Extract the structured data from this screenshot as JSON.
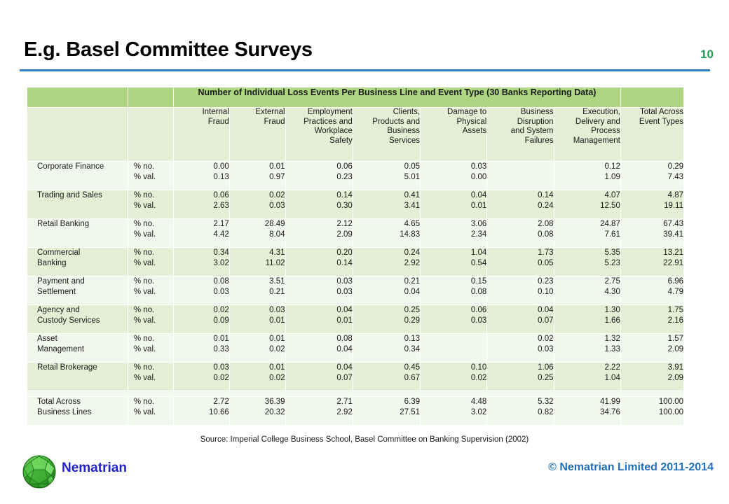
{
  "slide": {
    "title": "E.g. Basel Committee Surveys",
    "page_number": "10",
    "accent_rule_color": "#2f7fc6",
    "page_number_color": "#1f9d55"
  },
  "table": {
    "band_title": "Number of Individual Loss  Events  Per Business  Line and Event Type (30 Banks  Reporting Data)",
    "header_band_color": "#aed581",
    "row_color_light": "#f2f7ec",
    "row_color_dark": "#e3eed4",
    "column_headers": [
      "",
      "",
      "Internal\nFraud",
      "External\nFraud",
      "Employment\nPractices and\nWorkplace\nSafety",
      "Clients,\nProducts and\nBusiness\nServices",
      "Damage to\nPhysical\nAssets",
      "Business\nDisruption\nand System\nFailures",
      "Execution,\nDelivery  and\nProcess\nManagement",
      "Total Across\nEvent Types"
    ],
    "measure_labels": [
      "% no.",
      "% val."
    ],
    "rows": [
      {
        "label": "Corporate  Finance",
        "no": [
          "0.00",
          "0.01",
          "0.06",
          "0.05",
          "0.03",
          "",
          "0.12",
          "0.29"
        ],
        "val": [
          "0.13",
          "0.97",
          "0.23",
          "5.01",
          "0.00",
          "",
          "1.09",
          "7.43"
        ]
      },
      {
        "label": "Trading  and Sales",
        "no": [
          "0.06",
          "0.02",
          "0.14",
          "0.41",
          "0.04",
          "0.14",
          "4.07",
          "4.87"
        ],
        "val": [
          "2.63",
          "0.03",
          "0.30",
          "3.41",
          "0.01",
          "0.24",
          "12.50",
          "19.11"
        ]
      },
      {
        "label": "Retail Banking",
        "no": [
          "2.17",
          "28.49",
          "2.12",
          "4.65",
          "3.06",
          "2.08",
          "24.87",
          "67.43"
        ],
        "val": [
          "4.42",
          "8.04",
          "2.09",
          "14.83",
          "2.34",
          "0.08",
          "7.61",
          "39.41"
        ]
      },
      {
        "label": "Commercial\nBanking",
        "no": [
          "0.34",
          "4.31",
          "0.20",
          "0.24",
          "1.04",
          "1.73",
          "5.35",
          "13.21"
        ],
        "val": [
          "3.02",
          "11.02",
          "0.14",
          "2.92",
          "0.54",
          "0.05",
          "5.23",
          "22.91"
        ]
      },
      {
        "label": "Payment and\nSettlement",
        "no": [
          "0.08",
          "3.51",
          "0.03",
          "0.21",
          "0.15",
          "0.23",
          "2.75",
          "6.96"
        ],
        "val": [
          "0.03",
          "0.21",
          "0.03",
          "0.04",
          "0.08",
          "0.10",
          "4.30",
          "4.79"
        ]
      },
      {
        "label": "Agency and\nCustody Services",
        "no": [
          "0.02",
          "0.03",
          "0.04",
          "0.25",
          "0.06",
          "0.04",
          "1.30",
          "1.75"
        ],
        "val": [
          "0.09",
          "0.01",
          "0.01",
          "0.29",
          "0.03",
          "0.07",
          "1.66",
          "2.16"
        ]
      },
      {
        "label": "Asset\nManagement",
        "no": [
          "0.01",
          "0.01",
          "0.08",
          "0.13",
          "",
          "0.02",
          "1.32",
          "1.57"
        ],
        "val": [
          "0.33",
          "0.02",
          "0.04",
          "0.34",
          "",
          "0.03",
          "1.33",
          "2.09"
        ]
      },
      {
        "label": "Retail Brokerage",
        "no": [
          "0.03",
          "0.01",
          "0.04",
          "0.45",
          "0.10",
          "1.06",
          "2.22",
          "3.91"
        ],
        "val": [
          "0.02",
          "0.02",
          "0.07",
          "0.67",
          "0.02",
          "0.25",
          "1.04",
          "2.09"
        ]
      },
      {
        "label": "Total Across\nBusiness Lines",
        "no": [
          "2.72",
          "36.39",
          "2.71",
          "6.39",
          "4.48",
          "5.32",
          "41.99",
          "100.00"
        ],
        "val": [
          "10.66",
          "20.32",
          "2.92",
          "27.51",
          "3.02",
          "0.82",
          "34.76",
          "100.00"
        ]
      }
    ]
  },
  "source_note": "Source: Imperial College  Business School, Basel Committee on Banking Supervision  (2002)",
  "footer": {
    "brand": "Nematrian",
    "brand_color": "#2222cc",
    "copyright": "© Nematrian Limited 2011-2014",
    "copyright_color": "#1f6fba",
    "logo_icon": "polyhedron-sphere-icon"
  }
}
